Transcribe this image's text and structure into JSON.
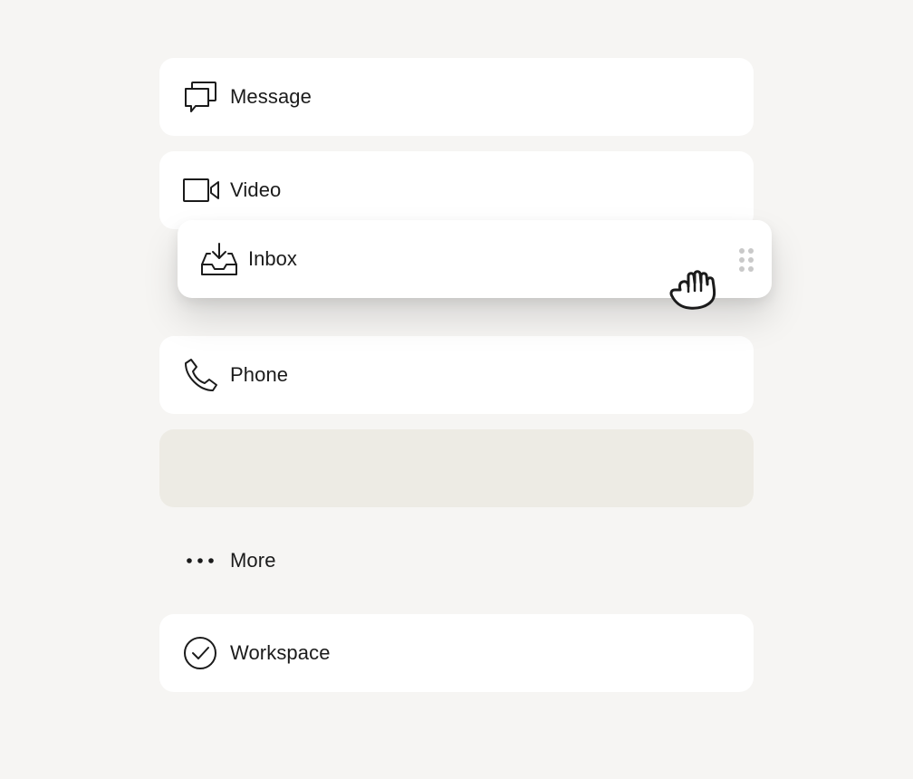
{
  "items": [
    {
      "label": "Message",
      "icon": "chat-bubbles-icon"
    },
    {
      "label": "Video",
      "icon": "video-camera-icon"
    },
    {
      "label": "Phone",
      "icon": "phone-icon"
    },
    {
      "label": "More",
      "icon": "more-dots-icon"
    },
    {
      "label": "Workspace",
      "icon": "check-circle-icon"
    }
  ],
  "dragging_item": {
    "label": "Inbox",
    "icon": "inbox-download-icon"
  },
  "colors": {
    "background": "#f6f5f3",
    "card": "#ffffff",
    "placeholder": "#edebe4",
    "text": "#1b1b1b"
  }
}
